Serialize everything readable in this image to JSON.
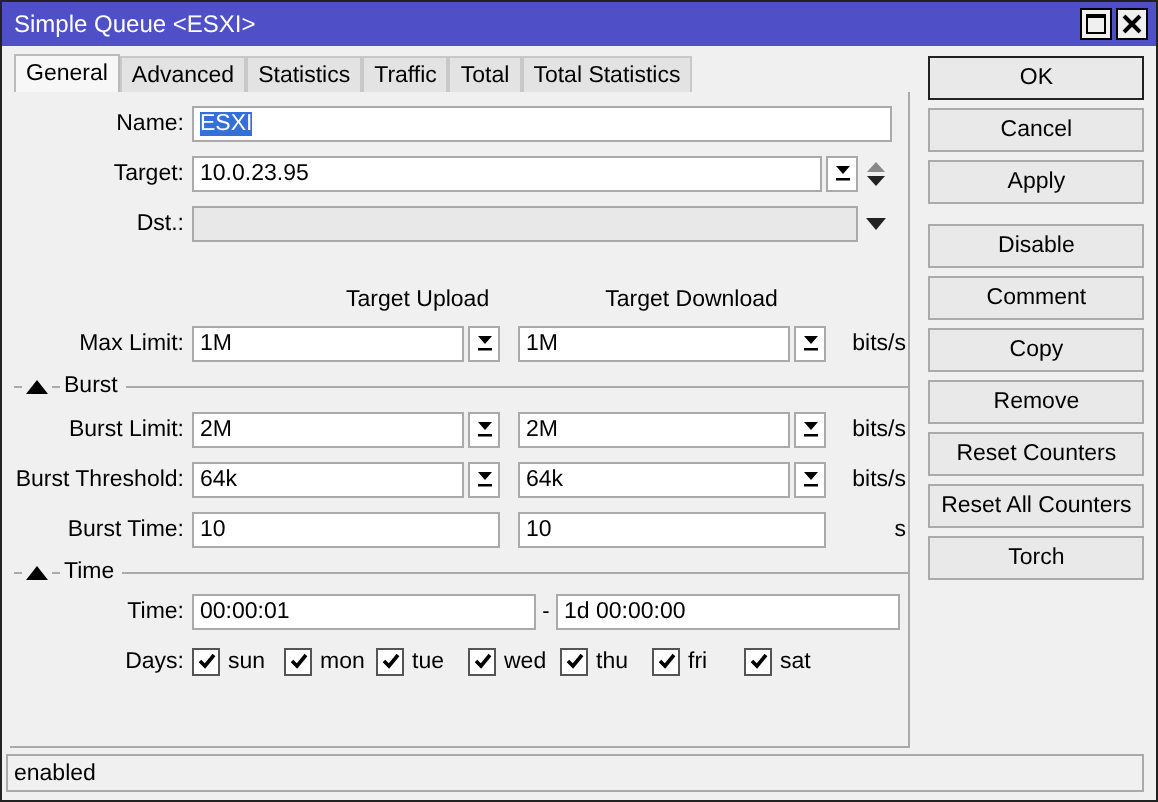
{
  "window": {
    "title": "Simple Queue <ESXI>"
  },
  "tabs": [
    {
      "label": "General",
      "selected": true
    },
    {
      "label": "Advanced",
      "selected": false
    },
    {
      "label": "Statistics",
      "selected": false
    },
    {
      "label": "Traffic",
      "selected": false
    },
    {
      "label": "Total",
      "selected": false
    },
    {
      "label": "Total Statistics",
      "selected": false
    }
  ],
  "name": {
    "label": "Name:",
    "value": "ESXI",
    "text_selected": true
  },
  "target": {
    "label": "Target:",
    "value": "10.0.23.95"
  },
  "dst": {
    "label": "Dst.:",
    "disabled": true
  },
  "limit_columns": [
    "Target Upload",
    "Target Download"
  ],
  "max_limit": {
    "label": "Max Limit:",
    "upload": "1M",
    "download": "1M",
    "unit": "bits/s",
    "kind": "dropdown"
  },
  "burst": {
    "title": "Burst",
    "expanded": true,
    "rows": [
      {
        "label": "Burst Limit:",
        "upload": "2M",
        "download": "2M",
        "unit": "bits/s",
        "kind": "dropdown"
      },
      {
        "label": "Burst Threshold:",
        "upload": "64k",
        "download": "64k",
        "unit": "bits/s",
        "kind": "dropdown"
      },
      {
        "label": "Burst Time:",
        "upload": "10",
        "download": "10",
        "unit": "s",
        "kind": "plain"
      }
    ]
  },
  "time": {
    "title": "Time",
    "expanded": true,
    "label": "Time:",
    "from": "00:00:01",
    "separator": "-",
    "to": "1d 00:00:00",
    "days_label": "Days:",
    "days": [
      {
        "label": "sun",
        "checked": true
      },
      {
        "label": "mon",
        "checked": true
      },
      {
        "label": "tue",
        "checked": true
      },
      {
        "label": "wed",
        "checked": true
      },
      {
        "label": "thu",
        "checked": true
      },
      {
        "label": "fri",
        "checked": true
      },
      {
        "label": "sat",
        "checked": true
      }
    ]
  },
  "buttons": [
    {
      "label": "OK",
      "default": true
    },
    {
      "label": "Cancel",
      "default": false
    },
    {
      "label": "Apply",
      "default": false
    },
    {
      "label": "Disable",
      "default": false
    },
    {
      "label": "Comment",
      "default": false
    },
    {
      "label": "Copy",
      "default": false
    },
    {
      "label": "Remove",
      "default": false
    },
    {
      "label": "Reset Counters",
      "default": false
    },
    {
      "label": "Reset All Counters",
      "default": false
    },
    {
      "label": "Torch",
      "default": false
    }
  ],
  "status_bar": "enabled"
}
